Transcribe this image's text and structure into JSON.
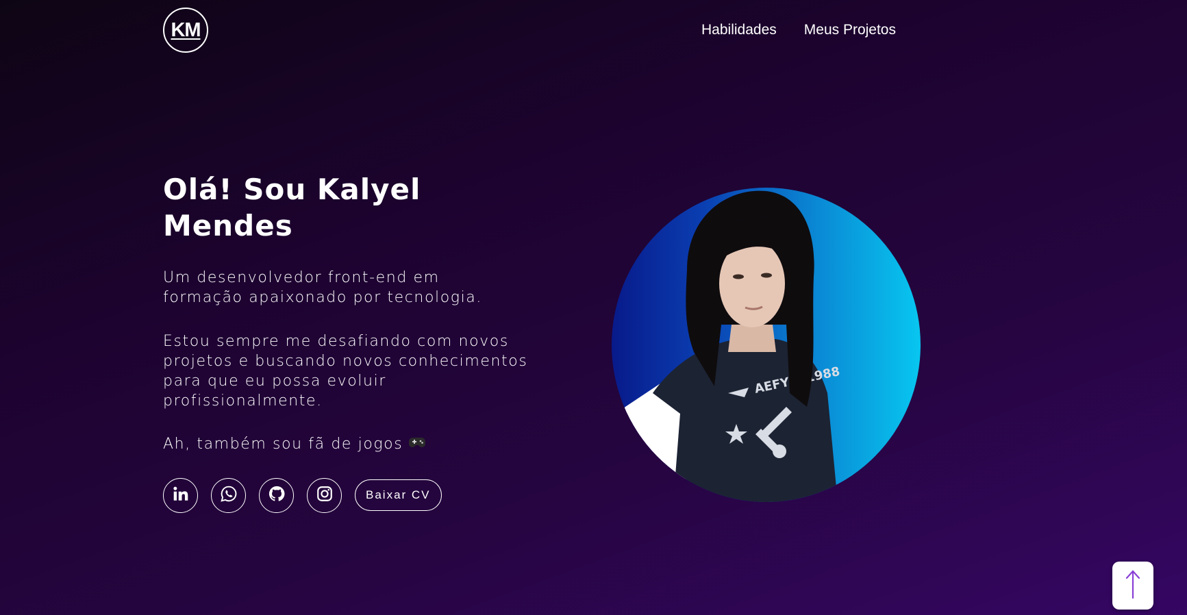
{
  "header": {
    "logo_text": "KM",
    "nav": [
      {
        "label": "Habilidades"
      },
      {
        "label": "Meus Projetos"
      }
    ]
  },
  "hero": {
    "title": "Olá! Sou Kalyel Mendes",
    "paragraph1": "Um desenvolvedor front-end em formação apaixonado por tecnologia.",
    "paragraph2": "Estou sempre me desafiando com novos projetos e buscando novos conhecimentos para que eu possa evoluir profissionalmente.",
    "paragraph3": "Ah, também sou fã de jogos",
    "socials": [
      {
        "icon": "linkedin-icon"
      },
      {
        "icon": "whatsapp-icon"
      },
      {
        "icon": "github-icon"
      },
      {
        "icon": "instagram-icon"
      }
    ],
    "cv_button": "Baixar CV"
  },
  "profile": {
    "shirt_print": "AEFYIT 1988"
  },
  "colors": {
    "background_dark": "#0e0514",
    "background_purple": "#350663",
    "photo_gradient_left": "#081a8a",
    "photo_gradient_right": "#08c6f0",
    "back_to_top_arrow": "#8a3fd6"
  }
}
